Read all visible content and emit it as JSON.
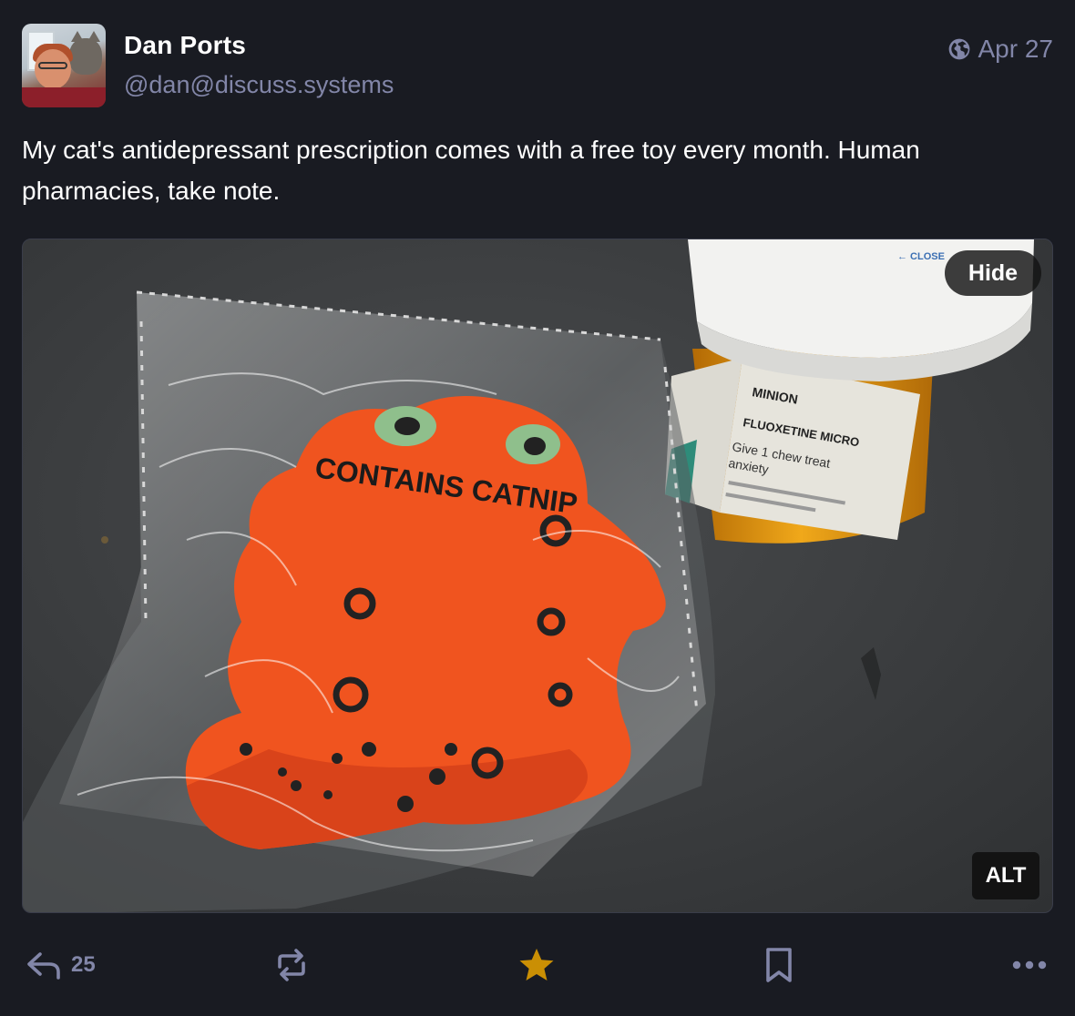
{
  "author": {
    "display_name": "Dan Ports",
    "handle": "@dan@discuss.systems"
  },
  "meta": {
    "visibility_icon": "globe-icon",
    "date": "Apr 27"
  },
  "content": {
    "text": "My cat's antidepressant prescription comes with a free toy every month. Human pharmacies, take note."
  },
  "media": {
    "hide_label": "Hide",
    "alt_label": "ALT"
  },
  "actions": {
    "reply_count": "25",
    "reply_icon": "reply-icon",
    "boost_icon": "boost-icon",
    "favourite_icon": "star-icon",
    "bookmark_icon": "bookmark-icon",
    "more_icon": "more-icon"
  },
  "colors": {
    "background": "#191b22",
    "muted_text": "#8286a8",
    "favourite_active": "#ca8f04"
  }
}
